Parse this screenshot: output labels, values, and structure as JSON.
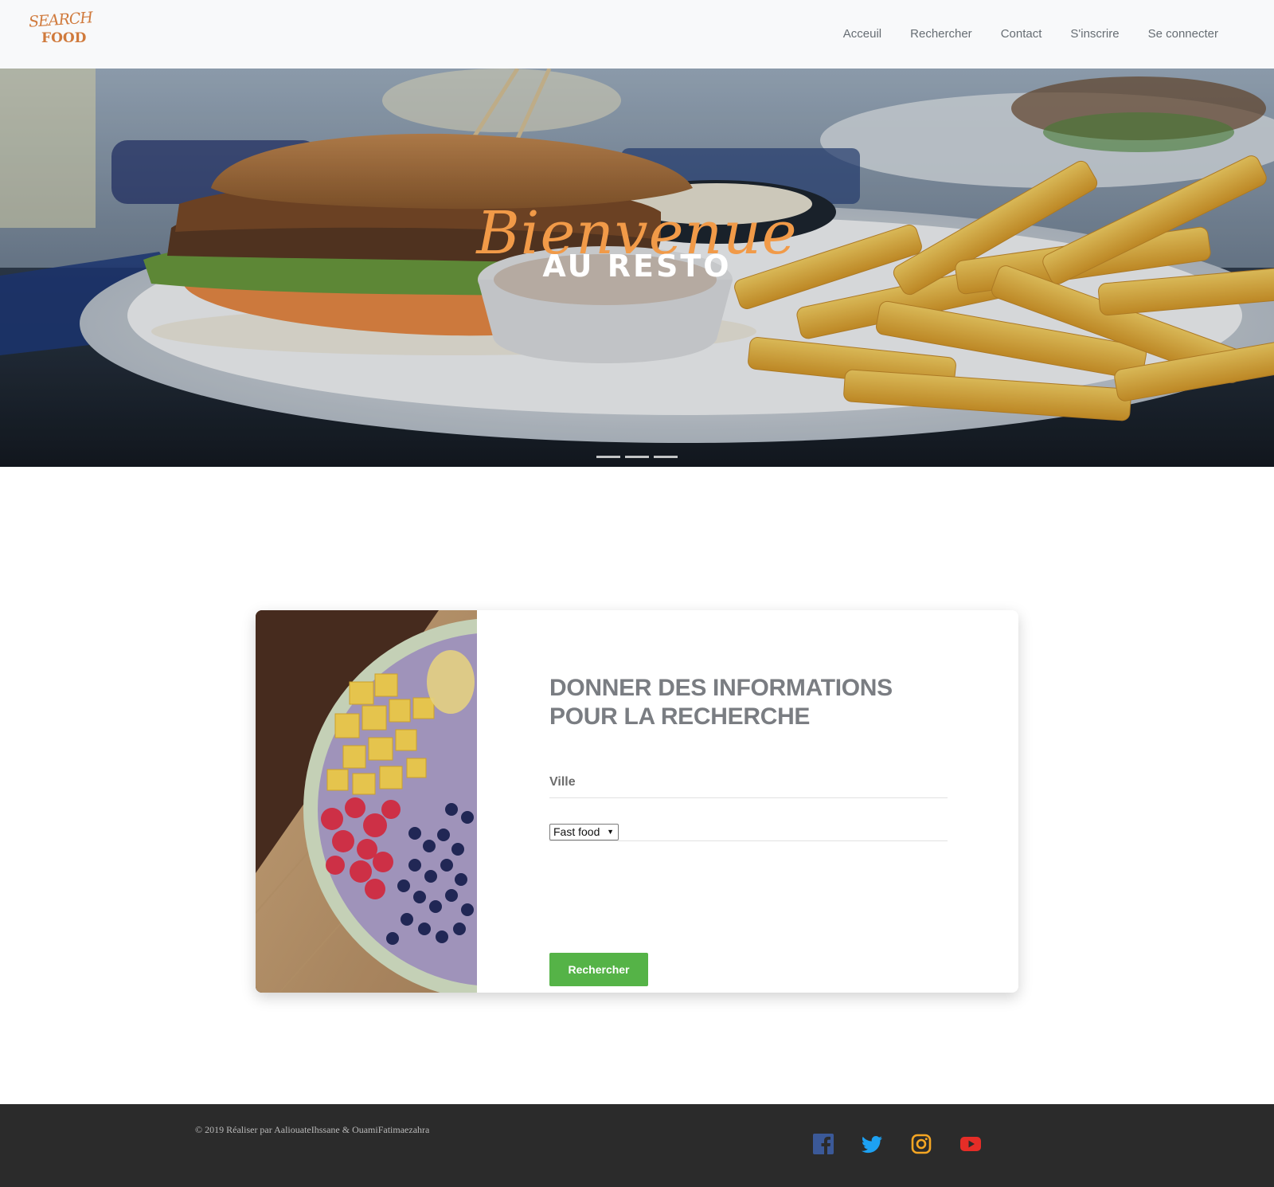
{
  "brand": {
    "line1": "SEARCH",
    "line2": "FOOD"
  },
  "nav": {
    "items": [
      "Acceuil",
      "Rechercher",
      "Contact",
      "S'inscrire",
      "Se connecter"
    ]
  },
  "hero": {
    "script_text": "Bienvenue",
    "title": "AU RESTO",
    "slides": 3,
    "active_slide": 1
  },
  "form": {
    "title": "DONNER DES INFORMATIONS POUR LA RECHERCHE",
    "ville_placeholder": "Ville",
    "ville_value": "",
    "category_selected": "Fast food",
    "submit_label": "Rechercher"
  },
  "footer": {
    "copyright": "© 2019 Réaliser par AaliouateIhssane & OuamiFatimaezahra",
    "social": [
      "facebook-icon",
      "twitter-icon",
      "instagram-icon",
      "youtube-icon"
    ]
  },
  "colors": {
    "accent": "#f19a48",
    "button": "#55b347",
    "facebook": "#3b5998",
    "twitter": "#1da1f2",
    "instagram": "#f5a623",
    "youtube": "#e52d27"
  }
}
